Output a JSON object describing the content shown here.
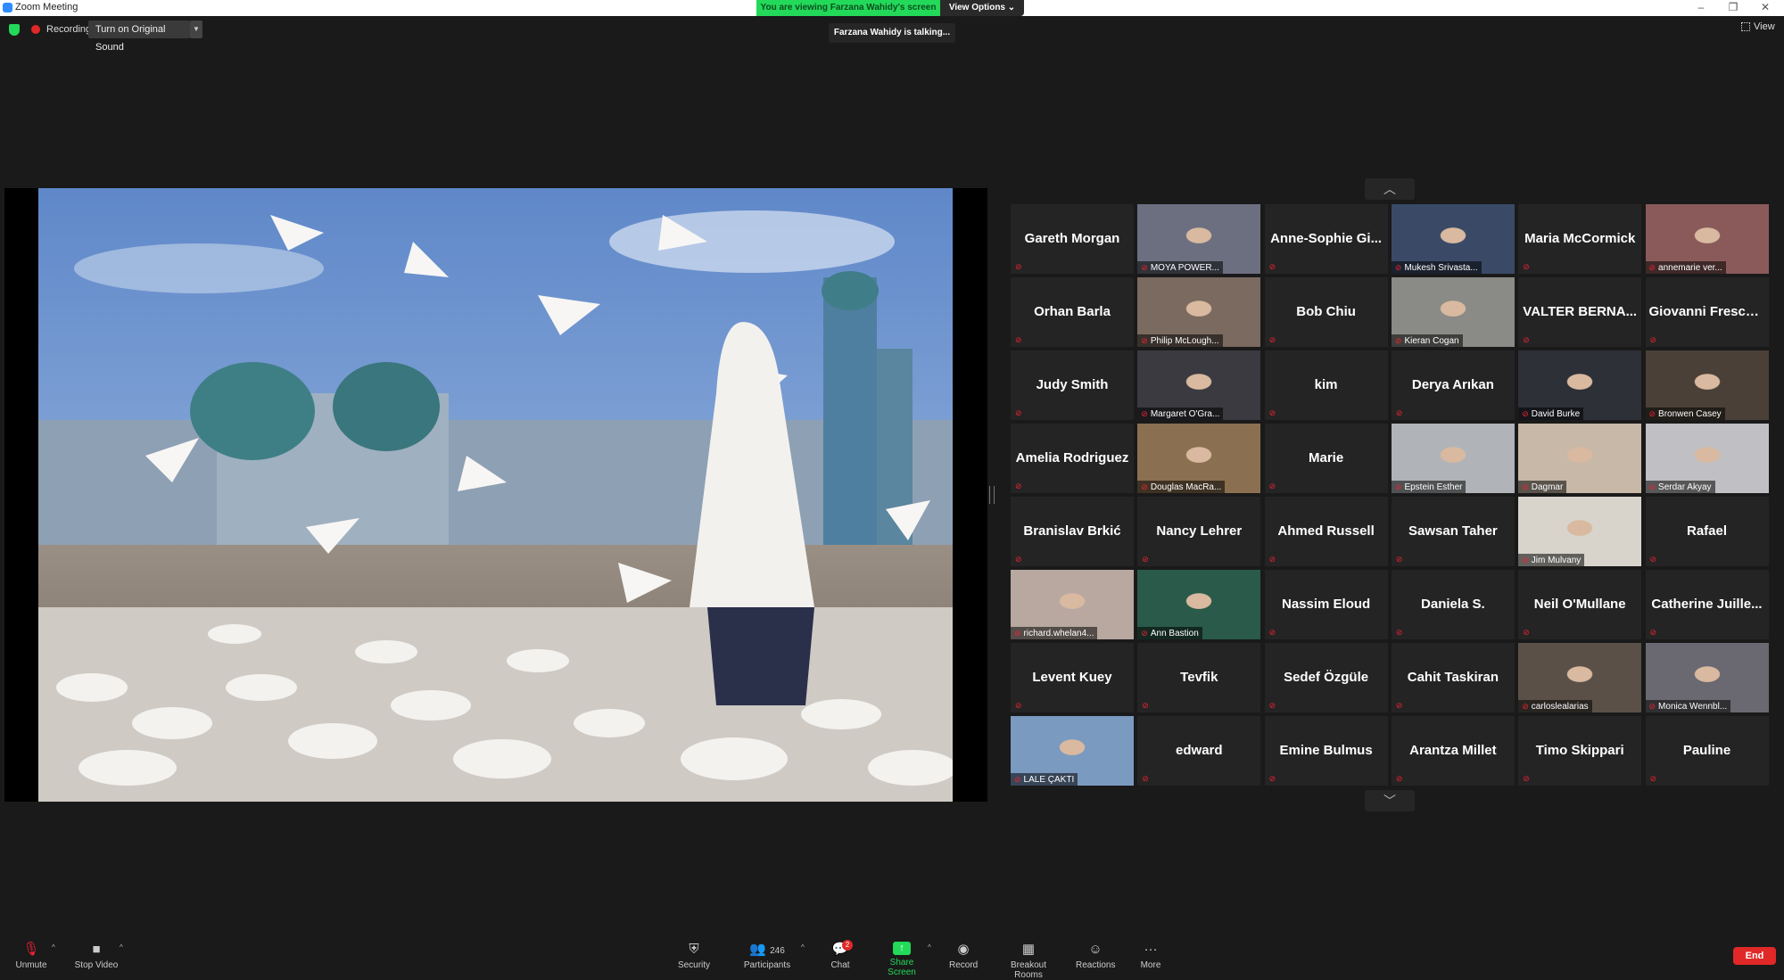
{
  "window": {
    "title": "Zoom Meeting"
  },
  "share_banner": {
    "viewing_text": "You are viewing Farzana Wahidy's screen",
    "view_options": "View Options"
  },
  "top_overlay": {
    "recording_label": "Recording",
    "original_sound_button": "Turn on Original Sound",
    "talking_indicator": "Farzana Wahidy is talking...",
    "view_button": "View"
  },
  "gallery": {
    "tiles": [
      {
        "name": "Gareth Morgan",
        "video": false
      },
      {
        "name": "MOYA POWER...",
        "video": true,
        "color": "#6b6f80"
      },
      {
        "name": "Anne-Sophie Gi...",
        "video": false
      },
      {
        "name": "Mukesh Srivasta...",
        "video": true,
        "color": "#3a4a66"
      },
      {
        "name": "Maria McCormick",
        "video": false
      },
      {
        "name": "annemarie ver...",
        "video": true,
        "color": "#8a5a5a"
      },
      {
        "name": "Orhan Barla",
        "video": false
      },
      {
        "name": "Philip McLough...",
        "video": true,
        "color": "#7a6a60"
      },
      {
        "name": "Bob Chiu",
        "video": false
      },
      {
        "name": "Kieran Cogan",
        "video": true,
        "color": "#8a8a86"
      },
      {
        "name": "VALTER BERNA...",
        "video": false
      },
      {
        "name": "Giovanni Frescura",
        "video": false
      },
      {
        "name": "Judy Smith",
        "video": false
      },
      {
        "name": "Margaret O'Gra...",
        "video": true,
        "color": "#3a3a40"
      },
      {
        "name": "kim",
        "video": false
      },
      {
        "name": "Derya Arıkan",
        "video": false
      },
      {
        "name": "David Burke",
        "video": true,
        "color": "#2e3038"
      },
      {
        "name": "Bronwen Casey",
        "video": true,
        "color": "#4a4038"
      },
      {
        "name": "Amelia Rodriguez",
        "video": false
      },
      {
        "name": "Douglas MacRa...",
        "video": true,
        "color": "#8a7050"
      },
      {
        "name": "Marie",
        "video": false
      },
      {
        "name": "Epstein Esther",
        "video": true,
        "color": "#b0b4b8"
      },
      {
        "name": "Dagmar",
        "video": true,
        "color": "#c8b8a8"
      },
      {
        "name": "Serdar Akyay",
        "video": true,
        "color": "#c0c0c4"
      },
      {
        "name": "Branislav Brkić",
        "video": false
      },
      {
        "name": "Nancy Lehrer",
        "video": false
      },
      {
        "name": "Ahmed Russell",
        "video": false
      },
      {
        "name": "Sawsan Taher",
        "video": false
      },
      {
        "name": "Jim Mulvany",
        "video": true,
        "color": "#d8d4cc"
      },
      {
        "name": "Rafael",
        "video": false
      },
      {
        "name": "richard.whelan4...",
        "video": true,
        "color": "#b8a8a0"
      },
      {
        "name": "Ann Bastion",
        "video": true,
        "color": "#2a5a4a"
      },
      {
        "name": "Nassim Eloud",
        "video": false
      },
      {
        "name": "Daniela S.",
        "video": false
      },
      {
        "name": "Neil O'Mullane",
        "video": false
      },
      {
        "name": "Catherine Juille...",
        "video": false
      },
      {
        "name": "Levent Kuey",
        "video": false
      },
      {
        "name": "Tevfik",
        "video": false
      },
      {
        "name": "Sedef Özgüle",
        "video": false
      },
      {
        "name": "Cahit Taskiran",
        "video": false
      },
      {
        "name": "carloslealarias",
        "video": true,
        "color": "#5a5048"
      },
      {
        "name": "Monica Wennbl...",
        "video": true,
        "color": "#6a6870"
      },
      {
        "name": "LALE ÇAKTI",
        "video": true,
        "color": "#7a9ac0"
      },
      {
        "name": "edward",
        "video": false
      },
      {
        "name": "Emine Bulmus",
        "video": false
      },
      {
        "name": "Arantza Millet",
        "video": false
      },
      {
        "name": "Timo Skippari",
        "video": false
      },
      {
        "name": "Pauline",
        "video": false
      }
    ]
  },
  "toolbar": {
    "unmute": "Unmute",
    "stop_video": "Stop Video",
    "security": "Security",
    "participants": "Participants",
    "participants_count": "246",
    "chat": "Chat",
    "chat_badge": "2",
    "share_screen": "Share Screen",
    "record": "Record",
    "breakout_rooms": "Breakout Rooms",
    "reactions": "Reactions",
    "more": "More",
    "end": "End"
  }
}
